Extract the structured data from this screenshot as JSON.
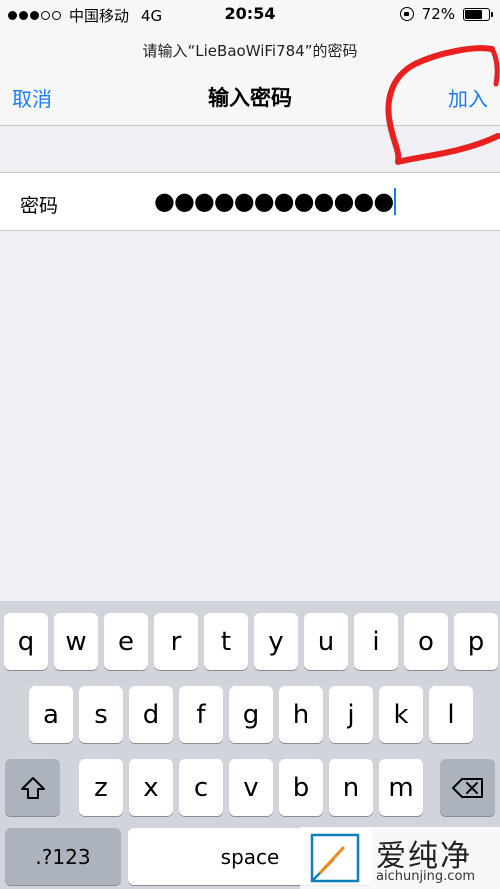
{
  "status_bar": {
    "carrier": "中国移动",
    "network": "4G",
    "time": "20:54",
    "battery": "72%",
    "battery_level": 0.72,
    "signal_bars_filled": 3,
    "signal_bars_total": 5
  },
  "nav": {
    "prompt": "请输入“LieBaoWiFi784”的密码",
    "cancel_label": "取消",
    "title": "输入密码",
    "join_label": "加入"
  },
  "form": {
    "password_label": "密码",
    "password_value": "●●●●●●●●●●●●"
  },
  "keyboard": {
    "row1": [
      "q",
      "w",
      "e",
      "r",
      "t",
      "y",
      "u",
      "i",
      "o",
      "p"
    ],
    "row2": [
      "a",
      "s",
      "d",
      "f",
      "g",
      "h",
      "j",
      "k",
      "l"
    ],
    "row3": [
      "z",
      "x",
      "c",
      "v",
      "b",
      "n",
      "m"
    ],
    "shift_icon": "shift-icon",
    "delete_icon": "backspace-icon",
    "numbers_label": ".?123",
    "space_label": "space"
  },
  "watermark": {
    "name": "爱纯净",
    "url": "aichunjing.com"
  },
  "colors": {
    "accent": "#1a7cf7",
    "annotation": "#e8201f"
  }
}
